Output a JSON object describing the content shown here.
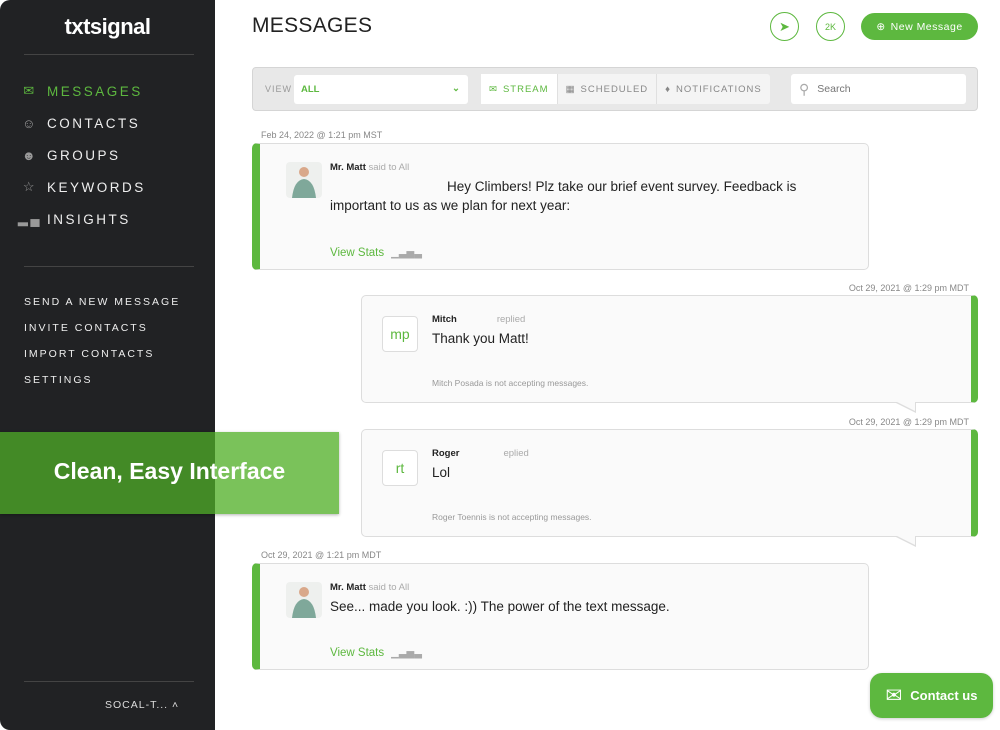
{
  "brand": {
    "logo": "txtsignal",
    "accent": "#5db83f",
    "sidebar_bg": "#212224"
  },
  "sidebar": {
    "nav": [
      {
        "label": "MESSAGES",
        "icon": "inbox-icon",
        "active": true
      },
      {
        "label": "CONTACTS",
        "icon": "user-icon"
      },
      {
        "label": "GROUPS",
        "icon": "group-icon"
      },
      {
        "label": "KEYWORDS",
        "icon": "star-icon"
      },
      {
        "label": "INSIGHTS",
        "icon": "chart-icon"
      }
    ],
    "links": [
      "SEND A NEW MESSAGE",
      "INVITE CONTACTS",
      "IMPORT CONTACTS",
      "SETTINGS"
    ],
    "account": "SOCAL-T..."
  },
  "header": {
    "title": "MESSAGES",
    "credits": "2K",
    "new_message": "New Message"
  },
  "toolbar": {
    "view_label": "VIEW",
    "view_value": "ALL",
    "tabs": [
      "STREAM",
      "SCHEDULED",
      "NOTIFICATIONS"
    ],
    "search_placeholder": "Search"
  },
  "messages": [
    {
      "timestamp": "Feb 24, 2022 @ 1:21 pm MST",
      "sender": "Mr. Matt",
      "action": "said to All",
      "body": "Hey Climbers! Plz take our brief event survey. Feedback is important to us as we plan for next year:",
      "stats": "View Stats"
    },
    {
      "timestamp": "Oct 29, 2021 @ 1:29 pm MDT",
      "sender": "Mitch",
      "initials": "mp",
      "action": "replied",
      "body": "Thank you Matt!",
      "note": "Mitch Posada is not accepting messages."
    },
    {
      "timestamp": "Oct 29, 2021 @ 1:29 pm MDT",
      "sender": "Roger",
      "initials": "rt",
      "action": "eplied",
      "body": "Lol",
      "note": "Roger Toennis is not accepting messages."
    },
    {
      "timestamp": "Oct 29, 2021 @ 1:21 pm MDT",
      "sender": "Mr. Matt",
      "action": "said to All",
      "body": "See... made you look. :)) The power of the text message.",
      "stats": "View Stats"
    }
  ],
  "banner": "Clean, Easy Interface",
  "contact": "Contact us"
}
